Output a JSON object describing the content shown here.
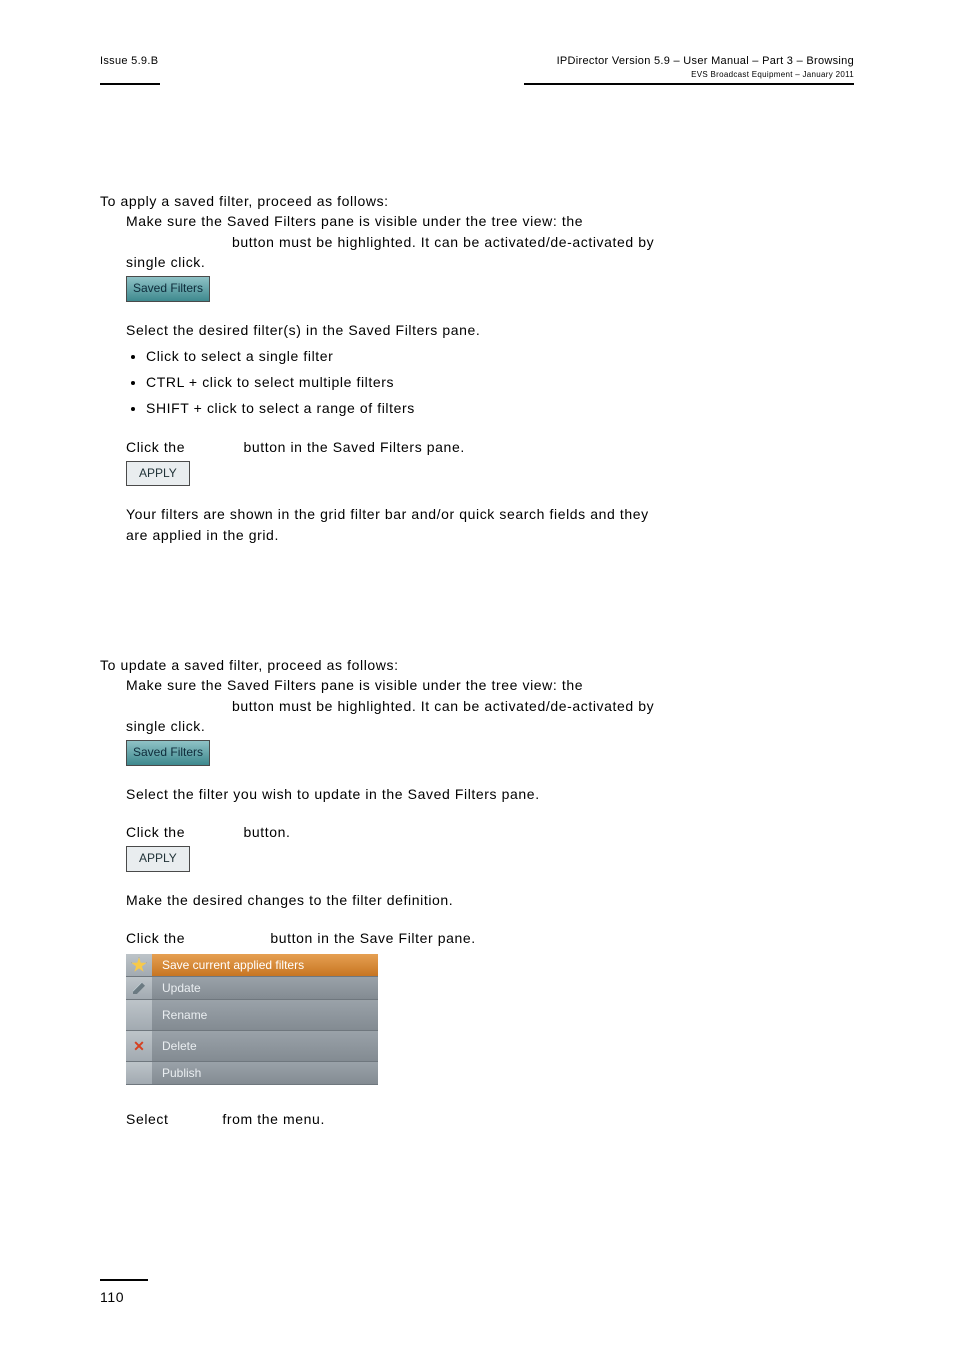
{
  "header": {
    "left": "Issue 5.9.B",
    "right_main": "IPDirector Version 5.9 – User Manual – Part 3 – Browsing",
    "right_sub": "EVS Broadcast Equipment – January 2011"
  },
  "section1": {
    "intro": "To apply a saved filter, proceed as follows:",
    "step1a": "Make sure the Saved Filters pane is visible under the tree view: the",
    "step1b": "button must be highlighted. It can be activated/de-activated by",
    "step1c": "single click.",
    "step2": "Select the desired filter(s) in the Saved Filters pane.",
    "bullets": [
      "Click to select a single filter",
      "CTRL + click to select multiple filters",
      "SHIFT + click to select a range of filters"
    ],
    "step3": "Click the             button in the Saved Filters pane.",
    "step4a": "Your filters are shown in the grid filter bar and/or quick search fields and they",
    "step4b": "are applied in the grid."
  },
  "section2": {
    "intro": "To update a saved filter, proceed as follows:",
    "step1a": "Make sure the Saved Filters pane is visible under the tree view: the",
    "step1b": "button must be highlighted. It can be activated/de-activated by",
    "step1c": "single click.",
    "step2": "Select the filter you wish to update in the Saved Filters pane.",
    "step3": "Click the             button.",
    "step4": "Make the desired changes to the filter definition.",
    "step5": "Click the                   button in the Save Filter pane.",
    "step6": "Select            from the menu."
  },
  "buttons": {
    "saved_filters": "Saved Filters",
    "apply": "APPLY"
  },
  "menu": {
    "items": [
      "Save current applied filters",
      "Update",
      "Rename",
      "Delete",
      "Publish"
    ]
  },
  "footer": {
    "page_number": "110"
  }
}
